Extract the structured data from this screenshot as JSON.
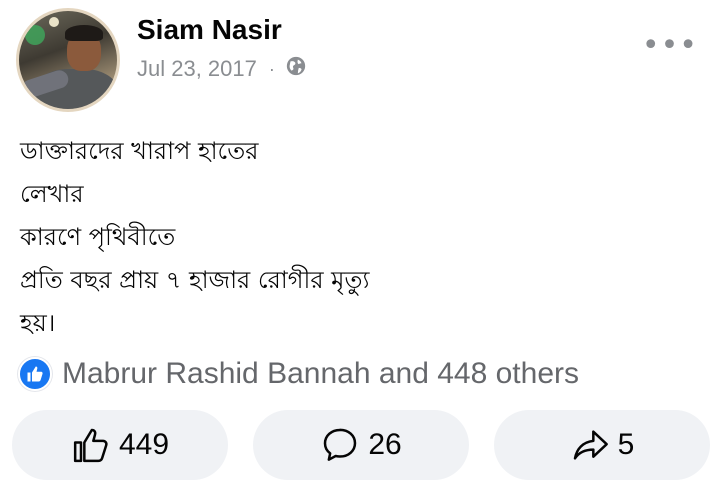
{
  "post": {
    "author": "Siam Nasir",
    "date": "Jul 23, 2017",
    "separator": "·",
    "privacy_icon": "globe-icon",
    "more_label": "•••",
    "body_lines": [
      "ডাক্তারদের খারাপ হাতের",
      "লেখার",
      "কারণে পৃথিবীতে",
      "প্রতি বছর প্রায় ৭ হাজার রোগীর মৃত্যু",
      "হয়।"
    ],
    "reactions_text": "Mabrur Rashid Bannah and 448 others",
    "actions": {
      "like_count": "449",
      "comment_count": "26",
      "share_count": "5"
    }
  },
  "colors": {
    "like_blue": "#1877f2",
    "secondary_text": "#65676b",
    "button_bg": "#f0f2f5"
  }
}
